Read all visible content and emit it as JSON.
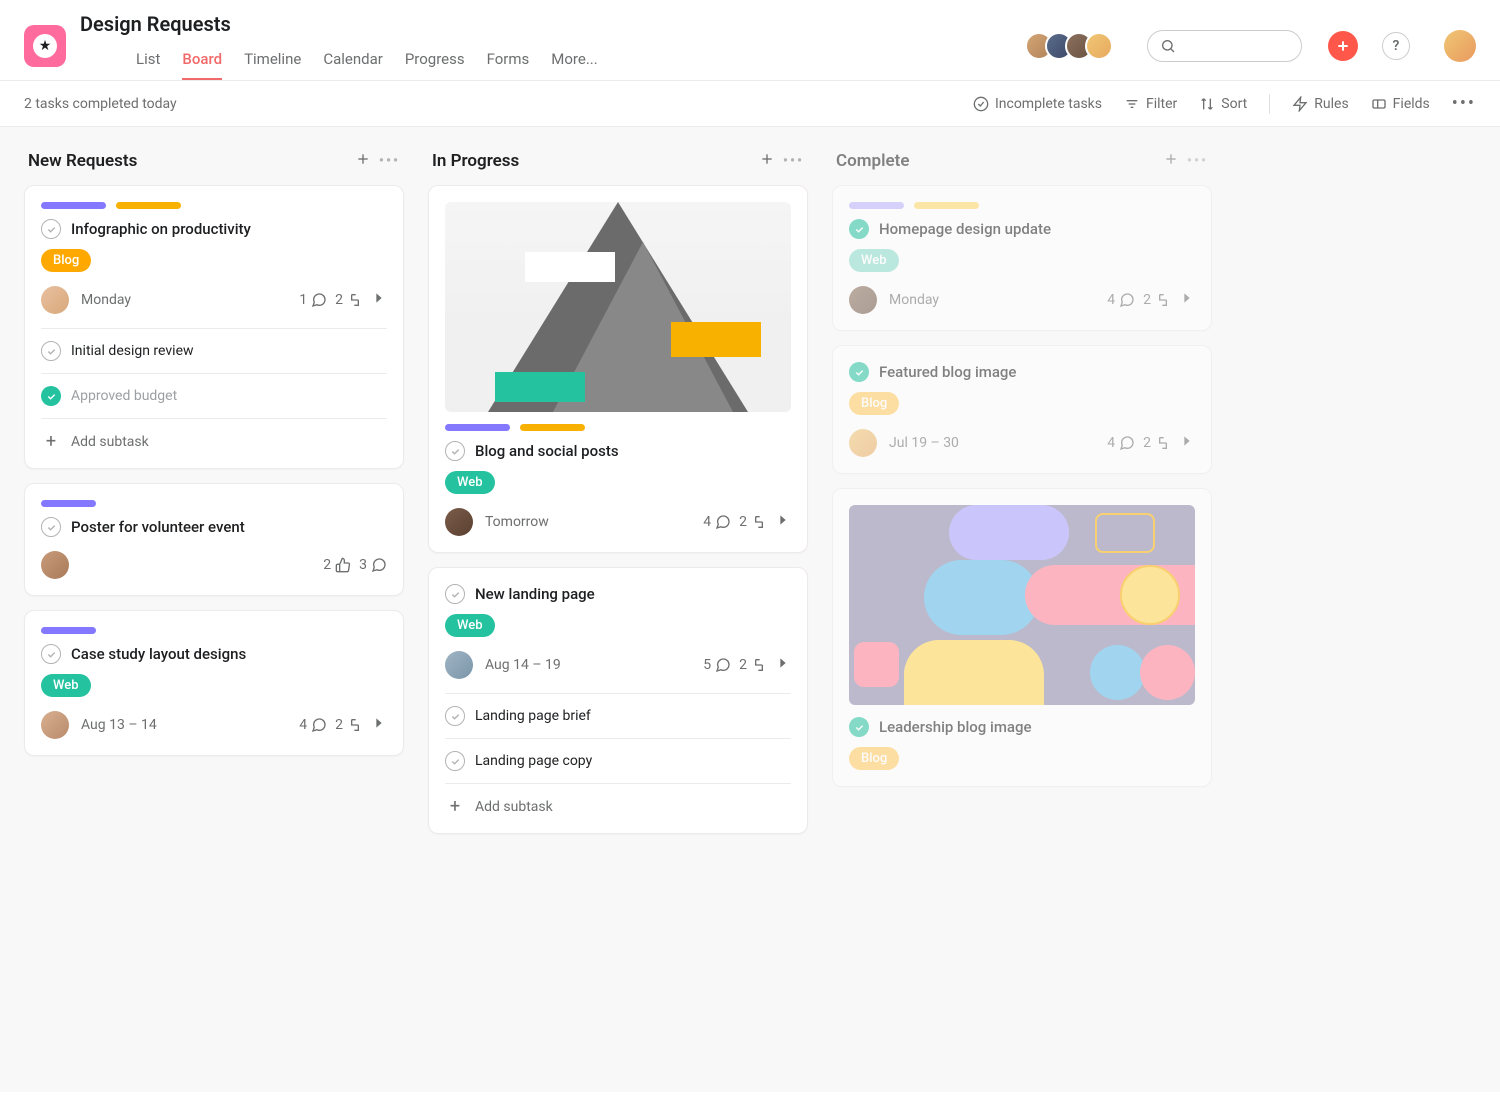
{
  "project": {
    "title": "Design Requests"
  },
  "tabs": [
    "List",
    "Board",
    "Timeline",
    "Calendar",
    "Progress",
    "Forms",
    "More..."
  ],
  "toolbar": {
    "status": "2 tasks completed today",
    "incomplete": "Incomplete tasks",
    "filter": "Filter",
    "sort": "Sort",
    "rules": "Rules",
    "fields": "Fields"
  },
  "columns": [
    {
      "title": "New Requests",
      "faded": false,
      "cards": [
        {
          "pills": [
            "purple",
            "orange"
          ],
          "title": "Infographic on productivity",
          "done": false,
          "tag": {
            "label": "Blog",
            "class": "blog"
          },
          "assignee": "av5",
          "date": "Monday",
          "stats": [
            [
              "1",
              "comment"
            ],
            [
              "2",
              "subtask"
            ]
          ],
          "expand": true,
          "subtasks": [
            {
              "title": "Initial design review",
              "done": false
            },
            {
              "title": "Approved budget",
              "done": true
            }
          ],
          "add_subtask": "Add subtask"
        },
        {
          "pills": [
            "purple-short"
          ],
          "title": "Poster for volunteer event",
          "done": false,
          "assignee": "av6",
          "stats": [
            [
              "2",
              "like"
            ],
            [
              "3",
              "comment"
            ]
          ]
        },
        {
          "pills": [
            "purple-short"
          ],
          "title": "Case study layout designs",
          "done": false,
          "tag": {
            "label": "Web",
            "class": "web"
          },
          "assignee": "av7",
          "date": "Aug 13 – 14",
          "stats": [
            [
              "4",
              "comment"
            ],
            [
              "2",
              "subtask"
            ]
          ],
          "expand": true
        }
      ]
    },
    {
      "title": "In Progress",
      "faded": false,
      "cards": [
        {
          "image": "mountain",
          "pills": [
            "purple",
            "orange"
          ],
          "title": "Blog and social posts",
          "done": false,
          "tag": {
            "label": "Web",
            "class": "web"
          },
          "assignee": "av8",
          "date": "Tomorrow",
          "stats": [
            [
              "4",
              "comment"
            ],
            [
              "2",
              "subtask"
            ]
          ],
          "expand": true
        },
        {
          "title": "New landing page",
          "done": false,
          "tag": {
            "label": "Web",
            "class": "web"
          },
          "assignee": "av9",
          "date": "Aug 14 – 19",
          "stats": [
            [
              "5",
              "comment"
            ],
            [
              "2",
              "subtask"
            ]
          ],
          "expand": true,
          "subtasks": [
            {
              "title": "Landing page brief",
              "done": false
            },
            {
              "title": "Landing page copy",
              "done": false
            }
          ],
          "add_subtask": "Add subtask"
        }
      ]
    },
    {
      "title": "Complete",
      "faded": true,
      "cards": [
        {
          "pills": [
            "purple-light",
            "orange-light"
          ],
          "title": "Homepage design update",
          "done": true,
          "tag": {
            "label": "Web",
            "class": "web-light"
          },
          "assignee": "av3",
          "date": "Monday",
          "stats": [
            [
              "4",
              "comment"
            ],
            [
              "2",
              "subtask"
            ]
          ],
          "expand": true
        },
        {
          "title": "Featured blog image",
          "done": true,
          "tag": {
            "label": "Blog",
            "class": "blog-light"
          },
          "assignee": "av4",
          "date": "Jul 19 – 30",
          "stats": [
            [
              "4",
              "comment"
            ],
            [
              "2",
              "subtask"
            ]
          ],
          "expand": true
        },
        {
          "image": "abstract",
          "title": "Leadership blog image",
          "done": true,
          "tag": {
            "label": "Blog",
            "class": "blog-light"
          }
        }
      ]
    }
  ]
}
